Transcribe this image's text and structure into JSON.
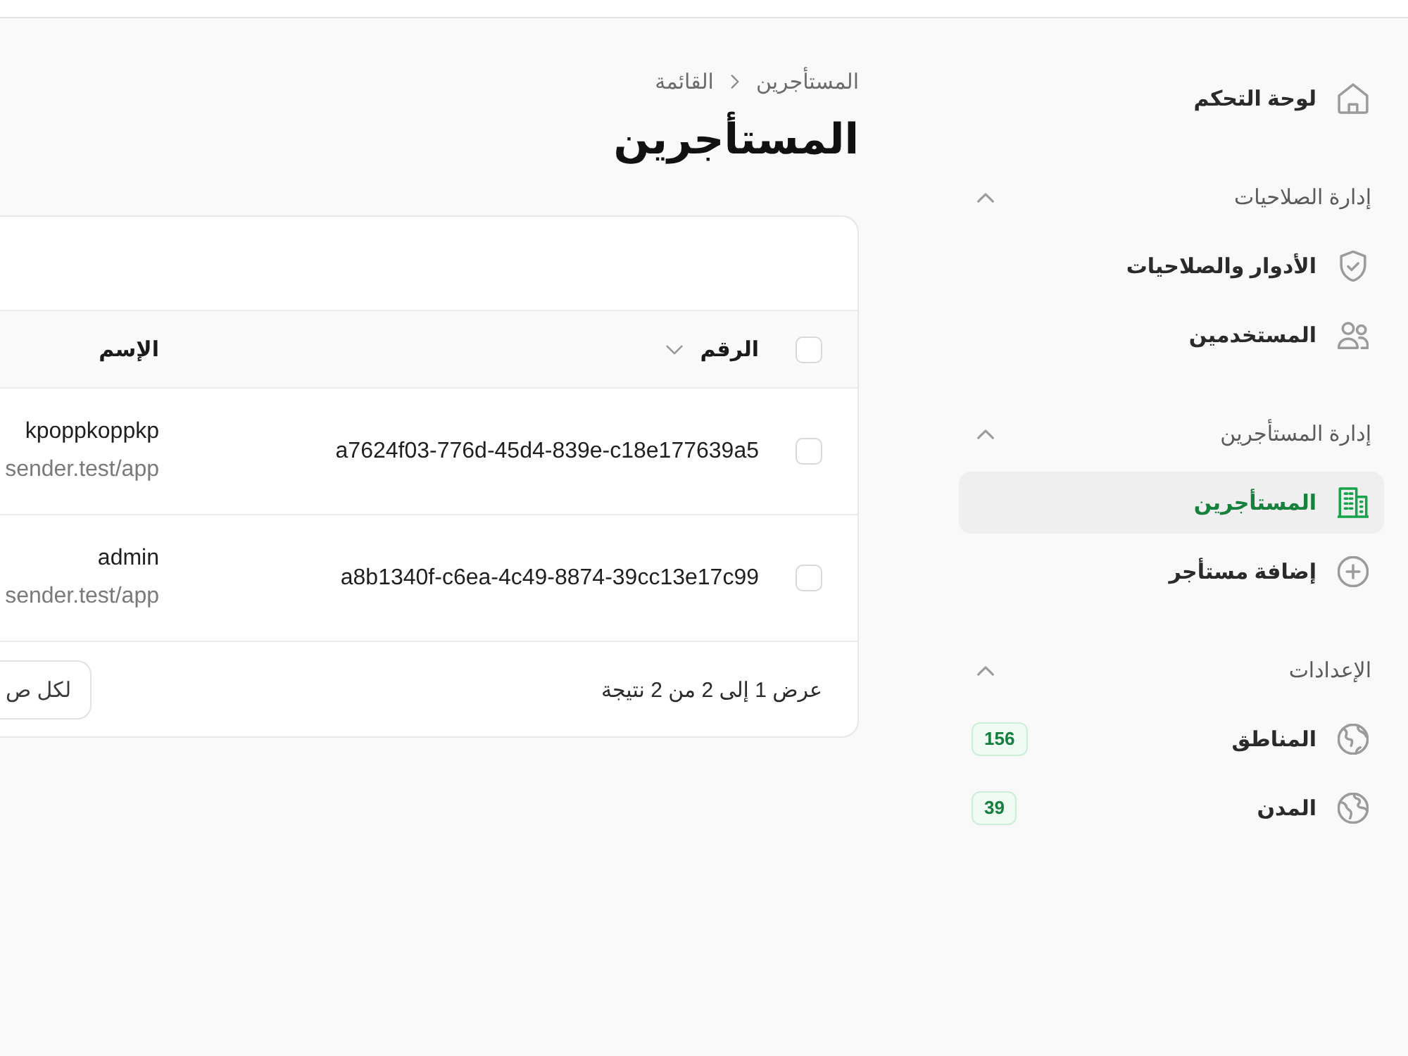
{
  "sidebar": {
    "sections": [
      {
        "items": [
          {
            "label": "لوحة التحكم",
            "selected": false
          }
        ]
      },
      {
        "title": "إدارة الصلاحيات",
        "expanded": true,
        "items": [
          {
            "label": "الأدوار والصلاحيات",
            "selected": false
          },
          {
            "label": "المستخدمين",
            "selected": false
          }
        ]
      },
      {
        "title": "إدارة المستأجرين",
        "expanded": true,
        "items": [
          {
            "label": "المستأجرين",
            "selected": true
          },
          {
            "label": "إضافة مستأجر",
            "selected": false
          }
        ]
      },
      {
        "title": "الإعدادات",
        "expanded": true,
        "items": [
          {
            "label": "المناطق",
            "selected": false,
            "badge": "156"
          },
          {
            "label": "المدن",
            "selected": false,
            "badge": "39"
          }
        ]
      }
    ]
  },
  "breadcrumb": [
    "المستأجرين",
    "القائمة"
  ],
  "page_title": "المستأجرين",
  "table": {
    "select_all": {
      "checked": false
    },
    "columns": [
      {
        "label": "الرقم",
        "sortable": true
      },
      {
        "label": "الإسم",
        "sortable": false
      }
    ],
    "rows": [
      {
        "checked": false,
        "id": "a7624f03-776d-45d4-839e-c18e177639a5",
        "name": "kpoppkoppkp",
        "subtitle": "sender.test/app"
      },
      {
        "checked": false,
        "id": "a8b1340f-c6ea-4c49-8874-39cc13e17c99",
        "name": "admin",
        "subtitle": "sender.test/app"
      }
    ],
    "summary": "عرض 1 إلى 2 من 2 نتيجة",
    "per_page_button": "لكل ص"
  }
}
